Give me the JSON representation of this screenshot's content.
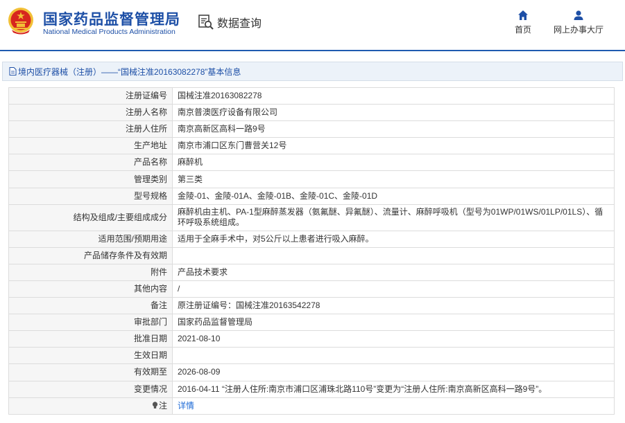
{
  "header": {
    "brand_cn": "国家药品监督管理局",
    "brand_en": "National Medical Products Administration",
    "query_label": "数据查询",
    "nav_home": "首页",
    "nav_hall": "网上办事大厅"
  },
  "breadcrumb": {
    "text": "境内医疗器械（注册）——“国械注准20163082278”基本信息"
  },
  "rows": [
    {
      "label": "注册证编号",
      "value": "国械注准20163082278"
    },
    {
      "label": "注册人名称",
      "value": "南京普澳医疗设备有限公司"
    },
    {
      "label": "注册人住所",
      "value": "南京高新区高科一路9号"
    },
    {
      "label": "生产地址",
      "value": "南京市浦口区东门曹营关12号"
    },
    {
      "label": "产品名称",
      "value": "麻醉机"
    },
    {
      "label": "管理类别",
      "value": "第三类"
    },
    {
      "label": "型号规格",
      "value": "金陵-01、金陵-01A、金陵-01B、金陵-01C、金陵-01D"
    },
    {
      "label": "结构及组成/主要组成成分",
      "value": "麻醉机由主机、PA-1型麻醉蒸发器（氨氟醚、异氟醚）、流量计、麻醉呼吸机（型号为01WP/01WS/01LP/01LS）、循环呼吸系统组成。"
    },
    {
      "label": "适用范围/预期用途",
      "value": "适用于全麻手术中，对5公斤以上患者进行吸入麻醉。"
    },
    {
      "label": "产品储存条件及有效期",
      "value": ""
    },
    {
      "label": "附件",
      "value": "产品技术要求"
    },
    {
      "label": "其他内容",
      "value": "/"
    },
    {
      "label": "备注",
      "value": "原注册证编号：国械注准20163542278"
    },
    {
      "label": "审批部门",
      "value": "国家药品监督管理局"
    },
    {
      "label": "批准日期",
      "value": "2021-08-10"
    },
    {
      "label": "生效日期",
      "value": ""
    },
    {
      "label": "有效期至",
      "value": "2026-08-09"
    },
    {
      "label": "变更情况",
      "value": "2016-04-11 “注册人住所:南京市浦口区浦珠北路110号”变更为“注册人住所:南京高新区高科一路9号”。"
    },
    {
      "label": "注",
      "value": "详情"
    }
  ],
  "colors": {
    "brand_blue": "#1d4fa6",
    "link_blue": "#1d6ad6",
    "emblem_red": "#d7261e",
    "emblem_gold": "#f2c037"
  }
}
